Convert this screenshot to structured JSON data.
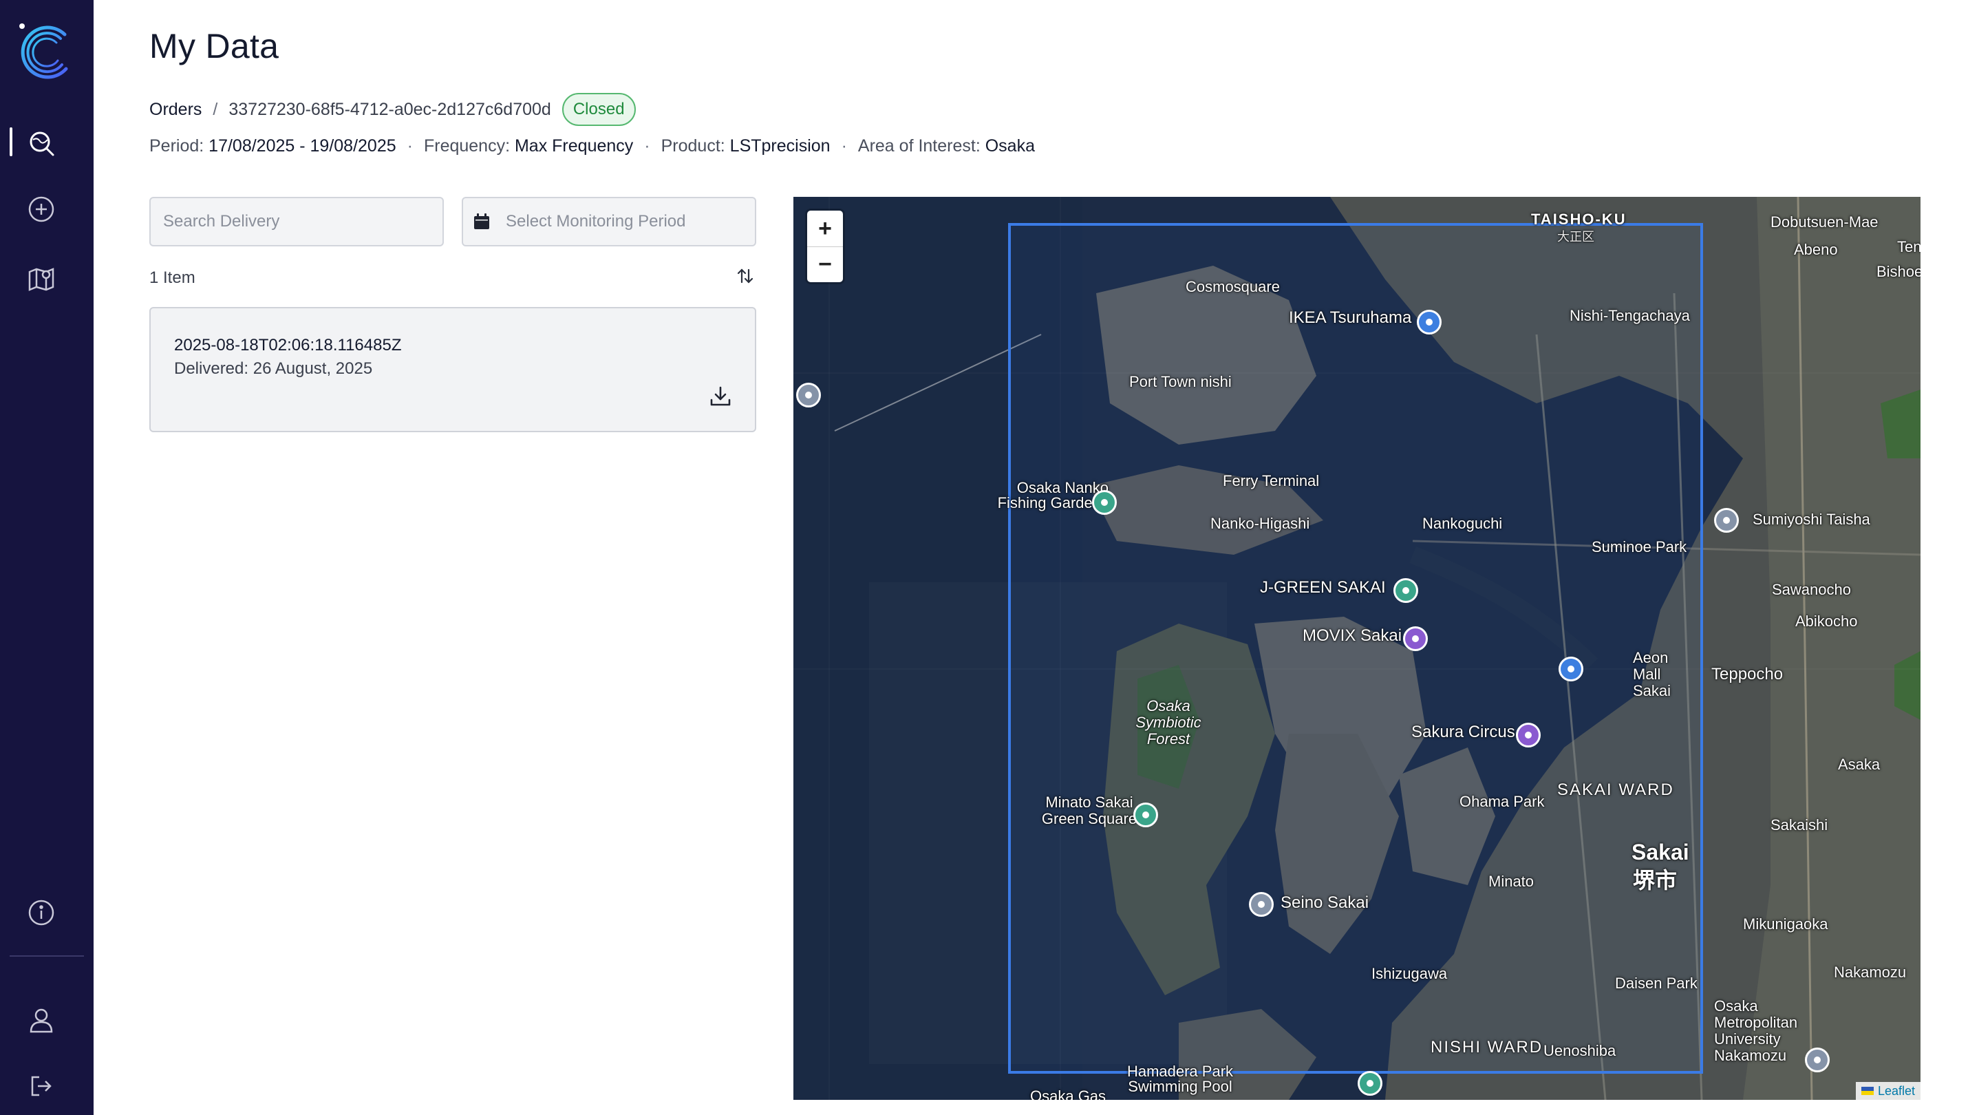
{
  "page": {
    "title": "My Data"
  },
  "breadcrumb": {
    "root": "Orders",
    "separator": "/",
    "order_id": "33727230-68f5-4712-a0ec-2d127c6d700d",
    "status": "Closed"
  },
  "meta": {
    "period_label": "Period:",
    "period_value": "17/08/2025 - 19/08/2025",
    "frequency_label": "Frequency:",
    "frequency_value": "Max Frequency",
    "product_label": "Product:",
    "product_value": "LSTprecision",
    "aoi_label": "Area of Interest:",
    "aoi_value": "Osaka",
    "separator": "·"
  },
  "filters": {
    "search_placeholder": "Search Delivery",
    "period_placeholder": "Select Monitoring Period"
  },
  "list": {
    "count": "1 Item",
    "items": [
      {
        "title": "2025-08-18T02:06:18.116485Z",
        "delivered": "Delivered: 26 August, 2025"
      }
    ]
  },
  "sidebar": {
    "items": [
      {
        "icon": "search-map-icon",
        "active": true
      },
      {
        "icon": "add-circle-icon",
        "active": false
      },
      {
        "icon": "map-pin-icon",
        "active": false
      },
      {
        "icon": "info-icon",
        "active": false
      },
      {
        "icon": "user-icon",
        "active": false
      },
      {
        "icon": "logout-icon",
        "active": false
      }
    ]
  },
  "map": {
    "zoom_in": "+",
    "zoom_out": "−",
    "attribution": "Leaflet",
    "aoi_color": "#3b7be6",
    "labels": {
      "taisho": "TAISHO-KU",
      "taisho_jp": "大正区",
      "cosmosquare": "Cosmosquare",
      "ikea": "IKEA Tsuruhama",
      "port_town": "Port Town nishi",
      "nanko_fishing": "Osaka Nanko Fishing Gardens",
      "ferry": "Ferry Terminal",
      "nanko_higashi": "Nanko-Higashi",
      "nankoguchi": "Nankoguchi",
      "nishi_tengachaya": "Nishi-Tengachaya",
      "suminoe_park": "Suminoe Park",
      "sumiyoshi_taisha": "Sumiyoshi Taisha",
      "jgreen": "J-GREEN SAKAI",
      "movix": "MOVIX Sakai",
      "osaka_forest": "Osaka Symbiotic Forest",
      "sakura_circus": "Sakura Circus",
      "minato_green": "Minato Sakai Green Square",
      "ohama": "Ohama Park",
      "sakai_ward": "SAKAI WARD",
      "sakai": "Sakai",
      "sakai_jp": "堺市",
      "seino": "Seino Sakai",
      "minato": "Minato",
      "ishizugawa": "Ishizugawa",
      "nishi_ward": "NISHI WARD",
      "uenoshiba": "Uenoshiba",
      "daisen": "Daisen Park",
      "mikunigaoka": "Mikunigaoka",
      "hamadera": "Hamadera Park Swimming Pool",
      "osaka_gas": "Osaka Gas",
      "abeno": "Abeno",
      "asaka": "Asaka",
      "sakaishi": "Sakaishi",
      "teppocho": "Teppocho",
      "aeon": "Aeon Mall Sakai",
      "abikocho": "Abikocho",
      "sawanocho": "Sawanocho",
      "opu": "Osaka Metropolitan University Nakamozu",
      "nakamozu": "Nakamozu",
      "doubutsuen": "Dobutsuen-Mae",
      "bishoen": "Bishoe",
      "tennoji": "Tenn"
    }
  }
}
